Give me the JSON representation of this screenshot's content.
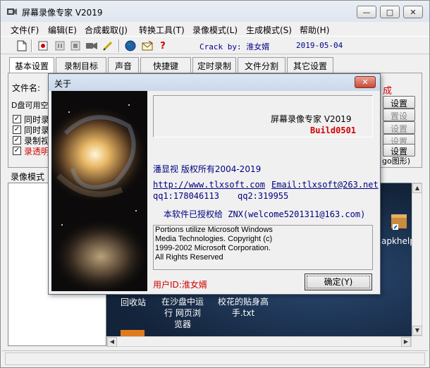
{
  "window": {
    "title": "屏幕录像专家 V2019",
    "minimize_glyph": "—",
    "maximize_glyph": "□",
    "close_glyph": "✕"
  },
  "menu": [
    "文件(F)",
    "编辑(E)",
    "合成截取(J)",
    "转换工具(T)",
    "录像模式(L)",
    "生成模式(S)",
    "帮助(H)"
  ],
  "toolbar": {
    "icons": [
      "new-file-icon",
      "record-icon",
      "pause-icon",
      "stop-icon",
      "fullscreen-icon",
      "camera-icon",
      "pen-icon",
      "globe-icon",
      "envelope-icon",
      "help-icon"
    ],
    "crack_text": "Crack by: 淮女婿",
    "date_text": "2019-05-04"
  },
  "tabs": [
    "基本设置",
    "录制目标",
    "声音",
    "快捷键",
    "定时录制",
    "文件分割",
    "其它设置"
  ],
  "panel": {
    "filename_label": "文件名:",
    "disk_label": "D盘可用空",
    "checks": [
      {
        "label": "同时录",
        "checked": true,
        "color": "#000000"
      },
      {
        "label": "同时录",
        "checked": true,
        "color": "#000000"
      },
      {
        "label": "录制视",
        "checked": true,
        "color": "#000000"
      },
      {
        "label": "录透明",
        "checked": true,
        "color": "#d00000"
      }
    ],
    "partial_red_text": "成",
    "buttons": [
      "设置",
      "置设",
      "设置",
      "设置",
      "设置"
    ],
    "logo_suffix": "go图形)"
  },
  "record_mode_label": "录像模式",
  "desktop": {
    "item_recycle": "回收站",
    "item_sandbox": "在沙盘中运行 网页浏览器",
    "item_file": "校花的贴身高手.txt",
    "item_apk": "apkhelp"
  },
  "about": {
    "title": "关于",
    "close_glyph": "✕",
    "product": "屏幕录像专家  V2019",
    "build": "Build0501",
    "copyright": "潘显视  版权所有2004-2019",
    "website": "http://www.tlxsoft.com",
    "email": "Email:tlxsoft@263.net",
    "qq1": "qq1:178046113",
    "qq2": "qq2:319955",
    "authorized": "本软件已授权给  ZNX(welcome5201311@163.com)",
    "ms_lines": [
      "Portions utilize Microsoft Windows",
      "Media Technologies.  Copyright (c)",
      "1999-2002 Microsoft Corporation.",
      "All Rights Reserved"
    ],
    "user_id": "用户ID:淮女婿",
    "ok_label": "确定(Y)",
    "accent_red": "#d00000",
    "accent_blue": "#000080"
  }
}
